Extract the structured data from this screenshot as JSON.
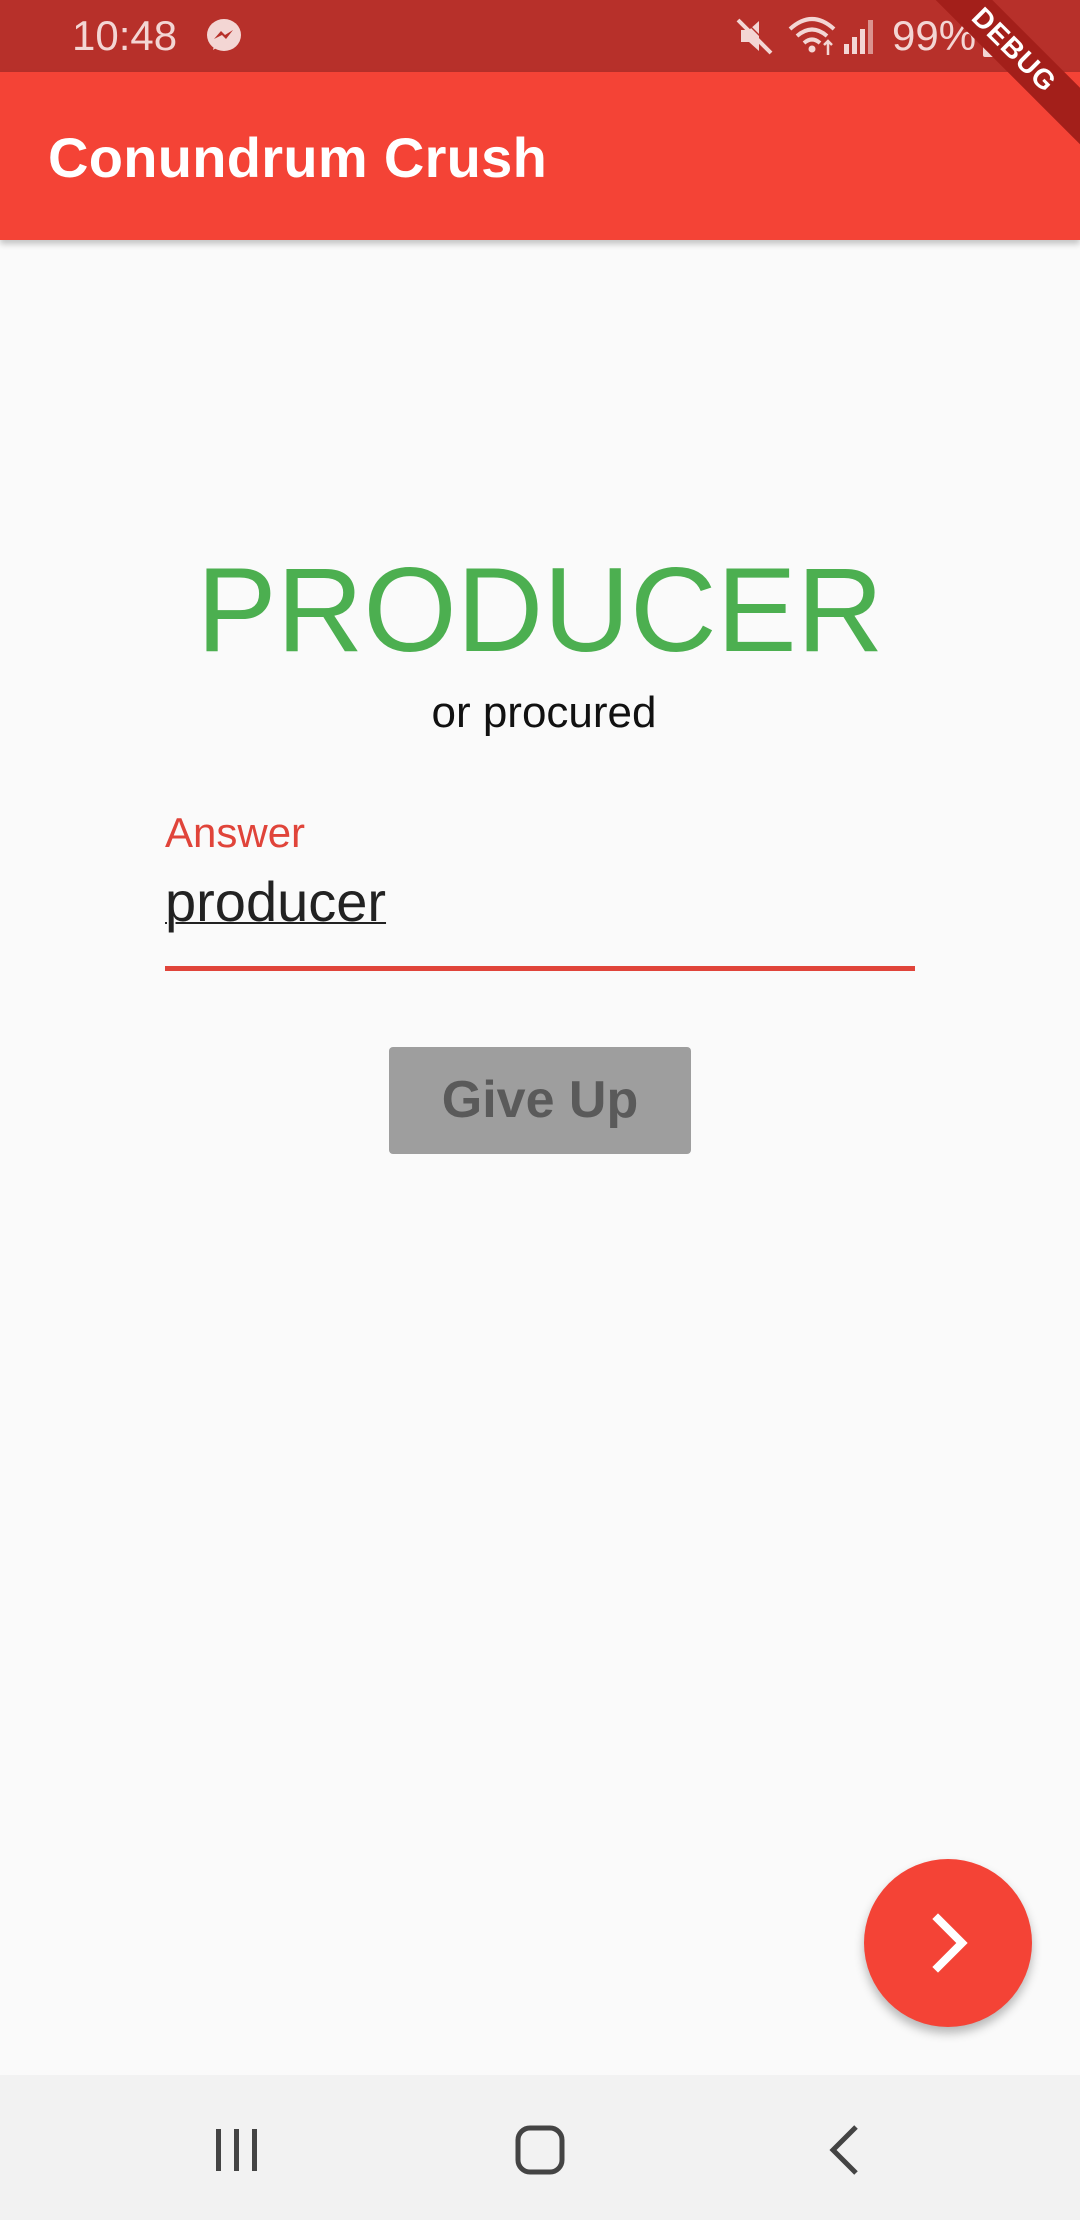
{
  "status_bar": {
    "time": "10:48",
    "battery": "99%",
    "icons": [
      "messenger-icon",
      "mute-icon",
      "wifi-icon",
      "signal-icon",
      "battery-icon"
    ]
  },
  "app_bar": {
    "title": "Conundrum Crush"
  },
  "debug_banner": {
    "label": "DEBUG"
  },
  "puzzle": {
    "word": "PRODUCER",
    "hint": "or procured"
  },
  "answer": {
    "label": "Answer",
    "value": "producer"
  },
  "give_up": {
    "label": "Give Up"
  },
  "fab": {
    "icon": "chevron-right-icon"
  },
  "nav": {
    "icons": [
      "recent-apps-icon",
      "home-icon",
      "back-icon"
    ]
  },
  "colors": {
    "primary": "#f44336",
    "status_bar": "#b7302a",
    "word": "#4caf50",
    "error_accent": "#e0443a",
    "button_disabled": "#9e9e9e"
  }
}
